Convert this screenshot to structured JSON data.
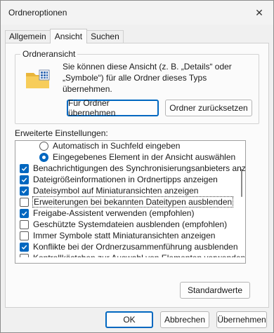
{
  "window": {
    "title": "Ordneroptionen",
    "close_glyph": "✕"
  },
  "tabs": [
    {
      "label": "Allgemein"
    },
    {
      "label": "Ansicht"
    },
    {
      "label": "Suchen"
    }
  ],
  "folder_view": {
    "group_label": "Ordneransicht",
    "description": "Sie können diese Ansicht (z. B. „Details“ oder „Symbole“) für alle Ordner dieses Typs übernehmen.",
    "apply_button": "Für Ordner übernehmen",
    "reset_button": "Ordner zurücksetzen"
  },
  "advanced": {
    "label": "Erweiterte Einstellungen:",
    "items": [
      {
        "type": "radio",
        "checked": false,
        "indent": 2,
        "label": "Automatisch in Suchfeld eingeben"
      },
      {
        "type": "radio",
        "checked": true,
        "indent": 2,
        "label": "Eingegebenes Element in der Ansicht auswählen"
      },
      {
        "type": "checkbox",
        "checked": true,
        "indent": 0,
        "label": "Benachrichtigungen des Synchronisierungsanbieters anzeig"
      },
      {
        "type": "checkbox",
        "checked": true,
        "indent": 0,
        "label": "Dateigrößeinformationen in Ordnertipps anzeigen"
      },
      {
        "type": "checkbox",
        "checked": true,
        "indent": 0,
        "label": "Dateisymbol auf Miniaturansichten anzeigen"
      },
      {
        "type": "checkbox",
        "checked": false,
        "indent": 0,
        "selected": true,
        "label": "Erweiterungen bei bekannten Dateitypen ausblenden"
      },
      {
        "type": "checkbox",
        "checked": true,
        "indent": 0,
        "label": "Freigabe-Assistent verwenden (empfohlen)"
      },
      {
        "type": "checkbox",
        "checked": false,
        "indent": 0,
        "label": "Geschützte Systemdateien ausblenden (empfohlen)"
      },
      {
        "type": "checkbox",
        "checked": false,
        "indent": 0,
        "label": "Immer Symbole statt Miniaturansichten anzeigen"
      },
      {
        "type": "checkbox",
        "checked": true,
        "indent": 0,
        "label": "Konflikte bei der Ordnerzusammenführung ausblenden"
      },
      {
        "type": "checkbox",
        "checked": false,
        "indent": 0,
        "label": "Kontrollkästchen zur Auswahl von Elementen verwenden"
      }
    ]
  },
  "defaults_button": "Standardwerte",
  "footer": {
    "ok": "OK",
    "cancel": "Abbrechen",
    "apply": "Übernehmen"
  },
  "colors": {
    "accent": "#0067c0",
    "folder": "#f4c24a"
  },
  "icons": {
    "folder": "folder-view-icon",
    "close": "close-icon",
    "check": "check-icon"
  }
}
